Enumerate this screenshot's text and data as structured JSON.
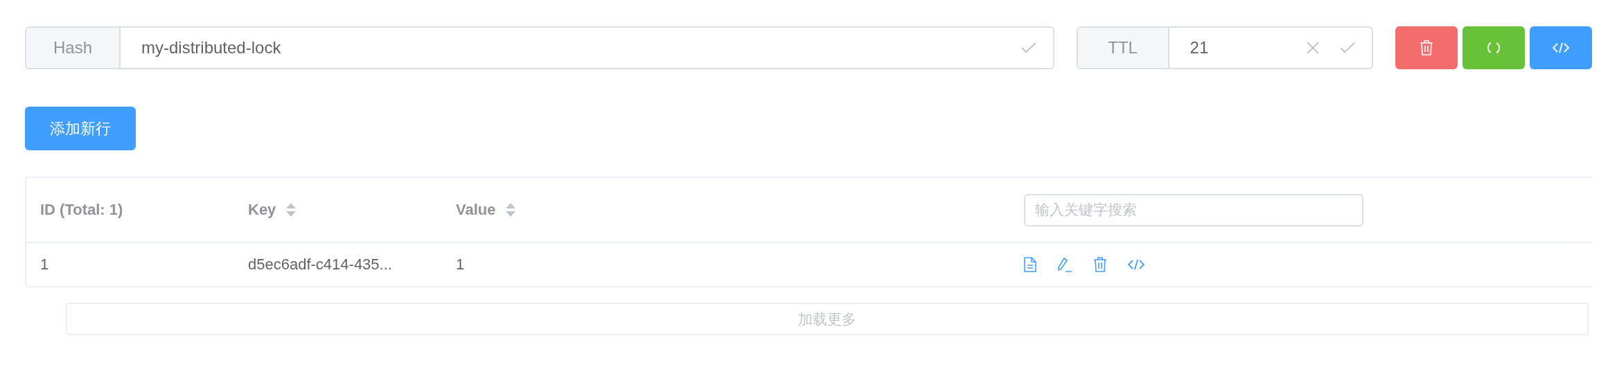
{
  "key_name": {
    "label": "Hash",
    "value": "my-distributed-lock"
  },
  "ttl": {
    "label": "TTL",
    "value": "21"
  },
  "add_button": "添加新行",
  "table": {
    "columns": [
      {
        "label": "ID (Total: 1)",
        "sortable": false
      },
      {
        "label": "Key",
        "sortable": true
      },
      {
        "label": "Value",
        "sortable": true
      }
    ],
    "search": {
      "placeholder": "输入关键字搜索"
    },
    "rows": [
      {
        "id": "1",
        "key": "d5ec6adf-c414-435...",
        "value": "1"
      }
    ]
  },
  "load_more": "加载更多"
}
